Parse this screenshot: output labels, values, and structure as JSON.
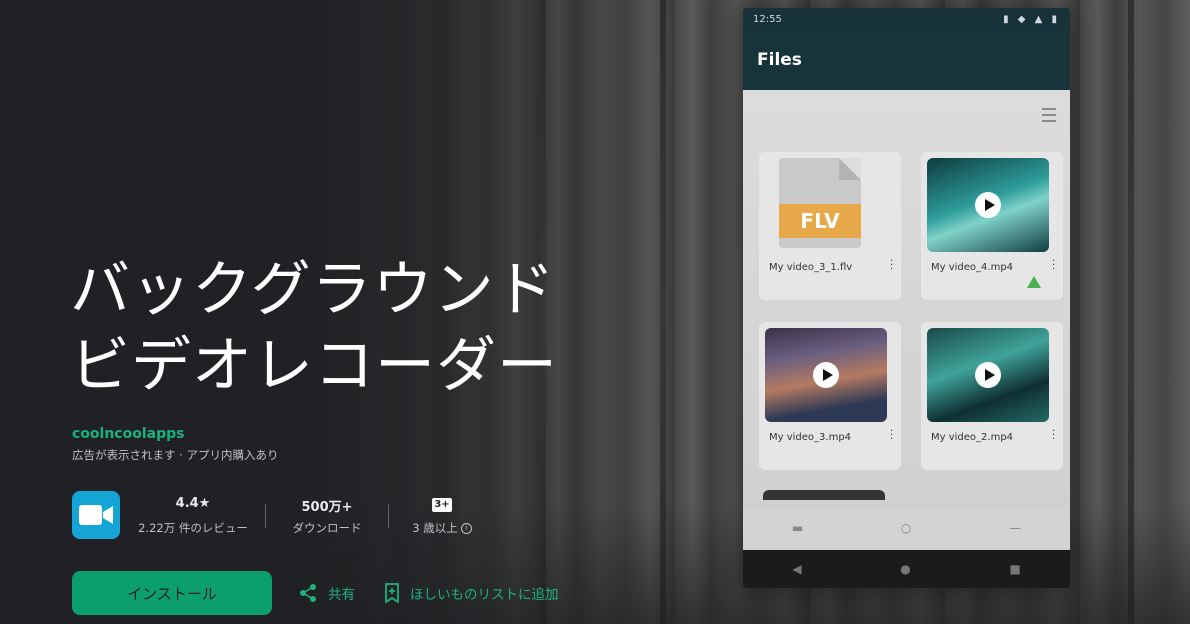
{
  "app": {
    "title_line1": "バックグラウンド",
    "title_line2": "ビデオレコーダー",
    "developer": "coolncoolapps",
    "subinfo": "広告が表示されます · アプリ内購入あり",
    "icon": "video-camera-icon",
    "brand_color": "#1db17e"
  },
  "stats": {
    "rating_value": "4.4★",
    "rating_label": "2.22万 件のレビュー",
    "downloads_value": "500万+",
    "downloads_label": "ダウンロード",
    "age_badge": "3+",
    "age_label": "3 歳以上"
  },
  "actions": {
    "install_label": "インストール",
    "share_label": "共有",
    "wishlist_label": "ほしいものリストに追加"
  },
  "screenshot": {
    "status_time": "12:55",
    "appbar_title": "Files",
    "files": [
      {
        "name": "My video_3_1.flv",
        "type": "flv",
        "thumb_label": "FLV"
      },
      {
        "name": "My video_4.mp4",
        "type": "video"
      },
      {
        "name": "My video_3.mp4",
        "type": "video"
      },
      {
        "name": "My video_2.mp4",
        "type": "video"
      }
    ]
  }
}
